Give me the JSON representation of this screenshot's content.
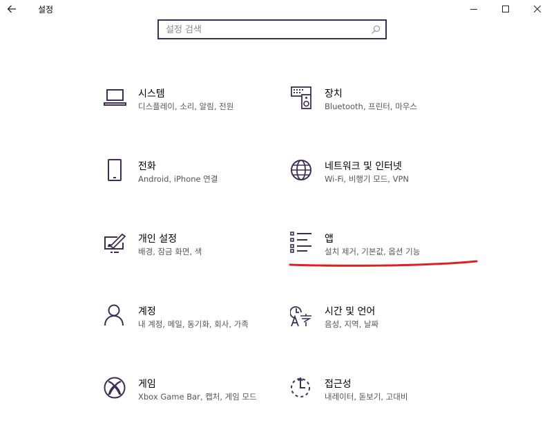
{
  "window": {
    "title": "설정"
  },
  "search": {
    "placeholder": "설정 검색",
    "value": ""
  },
  "tiles": [
    {
      "title": "시스템",
      "desc": "디스플레이, 소리, 알림, 전원"
    },
    {
      "title": "장치",
      "desc": "Bluetooth, 프린터, 마우스"
    },
    {
      "title": "전화",
      "desc": "Android, iPhone 연결"
    },
    {
      "title": "네트워크 및 인터넷",
      "desc": "Wi-Fi, 비행기 모드, VPN"
    },
    {
      "title": "개인 설정",
      "desc": "배경, 잠금 화면, 색"
    },
    {
      "title": "앱",
      "desc": "설치 제거, 기본값, 옵션 기능"
    },
    {
      "title": "계정",
      "desc": "내 계정, 메일, 동기화, 회사, 가족"
    },
    {
      "title": "시간 및 언어",
      "desc": "음성, 지역, 날짜"
    },
    {
      "title": "게임",
      "desc": "Xbox Game Bar, 캡처, 게임 모드"
    },
    {
      "title": "접근성",
      "desc": "내레이터, 돋보기, 고대비"
    }
  ],
  "icons": {
    "system": "laptop-icon",
    "devices": "keyboard-speaker-icon",
    "phone": "phone-icon",
    "network": "globe-icon",
    "personalization": "paint-brush-icon",
    "apps": "app-list-icon",
    "accounts": "person-icon",
    "time_language": "clock-language-icon",
    "gaming": "xbox-icon",
    "accessibility": "ease-of-access-icon"
  },
  "colors": {
    "accent": "#3b2c58",
    "annotation": "#e02020"
  }
}
